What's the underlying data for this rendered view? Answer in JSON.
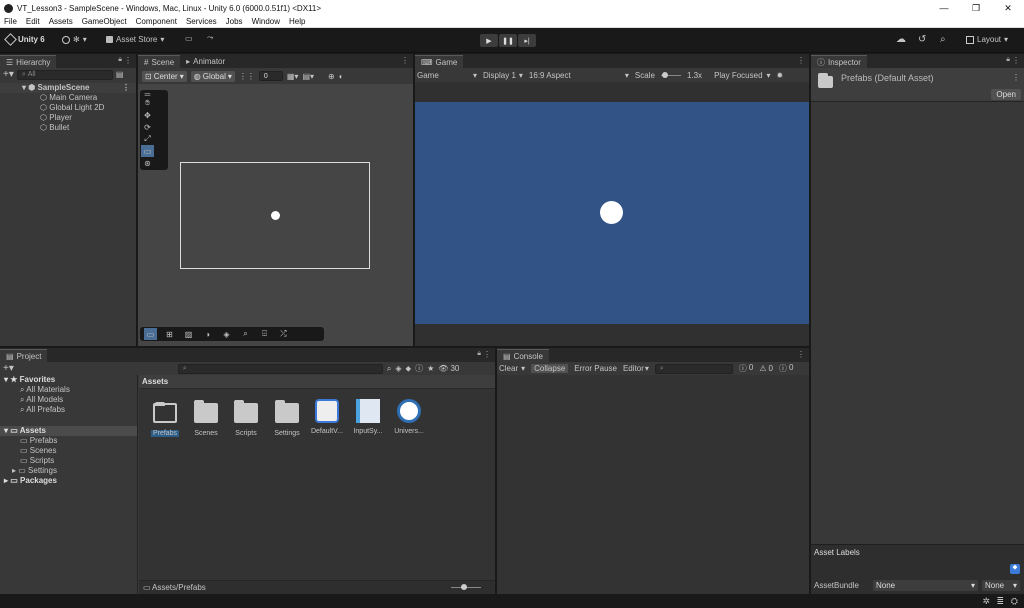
{
  "window": {
    "title": "VT_Lesson3 - SampleScene - Windows, Mac, Linux - Unity 6.0 (6000.0.51f1) <DX11>",
    "minimize": "—",
    "maximize": "❐",
    "close": "✕"
  },
  "menu": [
    "File",
    "Edit",
    "Assets",
    "GameObject",
    "Component",
    "Services",
    "Jobs",
    "Window",
    "Help"
  ],
  "toolbar": {
    "unity_label": "Unity 6",
    "account_label": "▾",
    "asset_store": "Asset Store",
    "layout_label": "Layout"
  },
  "hierarchy": {
    "tab": "Hierarchy",
    "search_placeholder": "All",
    "scene": "SampleScene",
    "items": [
      "Main Camera",
      "Global Light 2D",
      "Player",
      "Bullet"
    ]
  },
  "scene": {
    "tab_scene": "Scene",
    "tab_animator": "Animator",
    "pivot": "Center",
    "space": "Global",
    "grid_value": "0"
  },
  "game": {
    "tab": "Game",
    "mode": "Game",
    "display": "Display 1",
    "aspect": "16:9 Aspect",
    "scale_label": "Scale",
    "scale_value": "1.3x",
    "play_mode": "Play Focused",
    "viewport_color": "#325386"
  },
  "inspector": {
    "tab": "Inspector",
    "title": "Prefabs (Default Asset)",
    "open_btn": "Open",
    "labels_title": "Asset Labels",
    "bundle_label": "AssetBundle",
    "bundle_value": "None",
    "variant_value": "None"
  },
  "project": {
    "tab": "Project",
    "favorites": "Favorites",
    "fav_items": [
      "All Materials",
      "All Models",
      "All Prefabs"
    ],
    "assets": "Assets",
    "asset_folders": [
      "Prefabs",
      "Scenes",
      "Scripts",
      "Settings"
    ],
    "packages": "Packages",
    "breadcrumb": "Assets",
    "grid_items": [
      "Prefabs",
      "Scenes",
      "Scripts",
      "Settings",
      "DefaultV...",
      "InputSy...",
      "Univers..."
    ],
    "footer_path": "Assets/Prefabs",
    "count": "30"
  },
  "console": {
    "tab": "Console",
    "clear": "Clear",
    "collapse": "Collapse",
    "error_pause": "Error Pause",
    "editor": "Editor",
    "logs": "0",
    "warnings": "0",
    "errors": "0"
  }
}
